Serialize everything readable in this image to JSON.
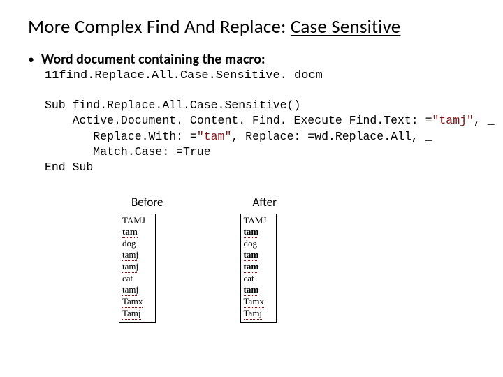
{
  "title": {
    "prefix": "More Complex Find And Replace: ",
    "underlined": "Case Sensitive"
  },
  "bullet": "Word document containing the macro:",
  "filename": "11find.Replace.All.Case.Sensitive. docm",
  "code": {
    "l1": "Sub find.Replace.All.Case.Sensitive()",
    "l2a": "    Active.Document. Content. Find. Execute Find.Text: =",
    "l2s": "\"tamj\"",
    "l2b": ", _",
    "l3a": "       Replace.With: =",
    "l3s": "\"tam\"",
    "l3b": ", Replace: =wd.Replace.All, _",
    "l4": "       Match.Case: =True",
    "l5": "End Sub"
  },
  "before": {
    "label": "Before",
    "items": [
      "TAMJ",
      "tam",
      "dog",
      "tamj",
      "tamj",
      "cat",
      "tamj",
      "Tamx",
      "Tamj"
    ]
  },
  "after": {
    "label": "After",
    "items": [
      "TAMJ",
      "tam",
      "dog",
      "tam",
      "tam",
      "cat",
      "tam",
      "Tamx",
      "Tamj"
    ]
  }
}
